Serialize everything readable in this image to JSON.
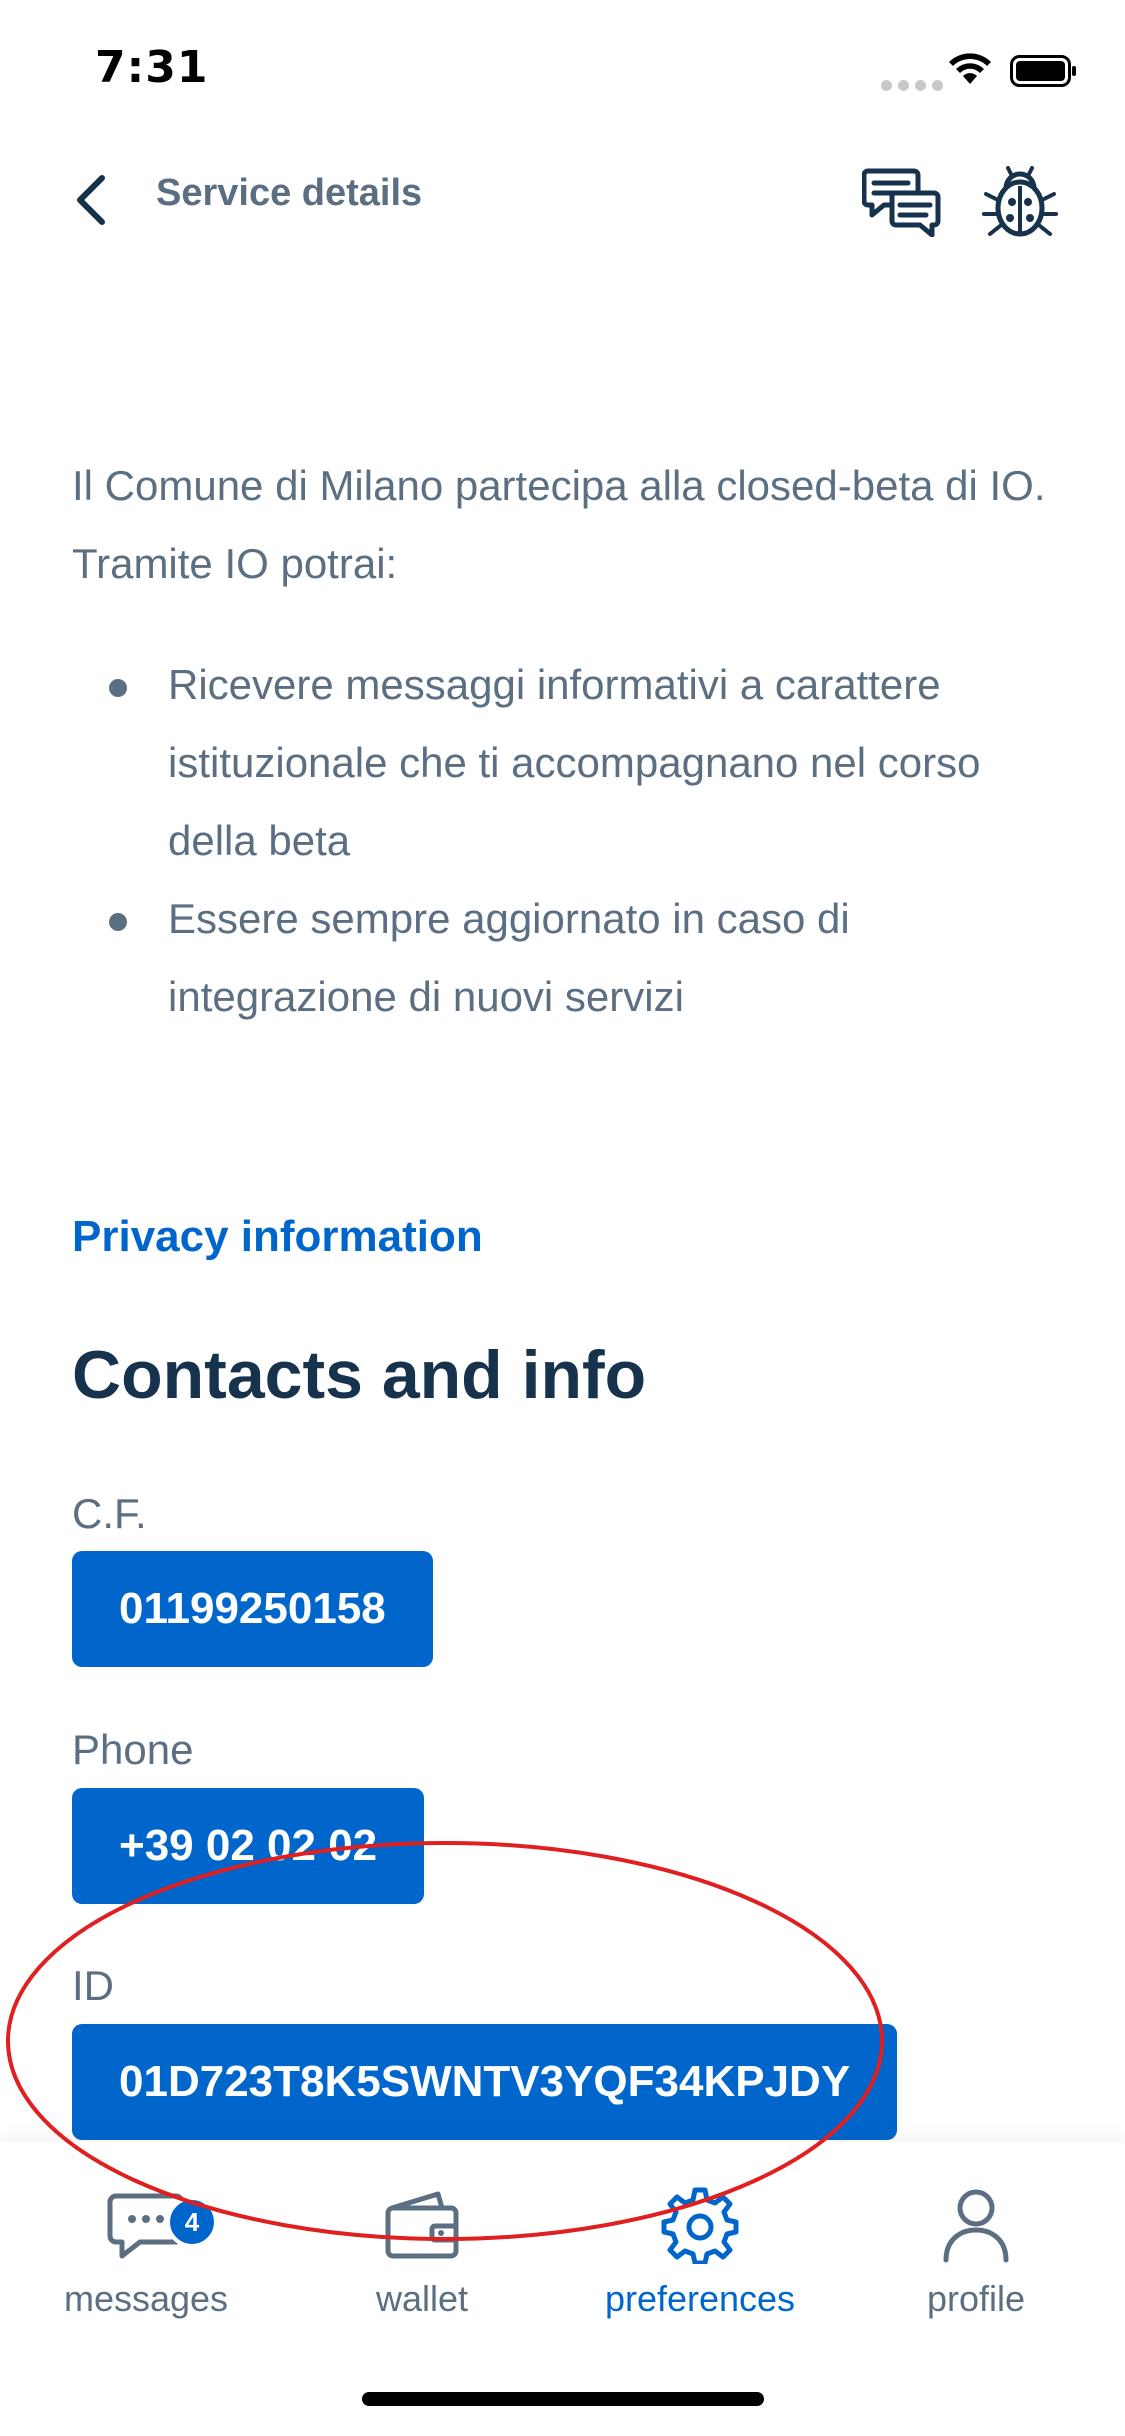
{
  "status_bar": {
    "time": "7:31"
  },
  "header": {
    "title": "Service details",
    "back_icon": "chevron-left-icon",
    "chat_icon": "chat-icon",
    "bug_icon": "bug-icon"
  },
  "description": {
    "intro": "Il Comune di Milano partecipa alla closed-beta di IO. Tramite IO potrai:",
    "bullets": [
      "Ricevere messaggi informativi a carattere istituzionale che ti accompagnano nel corso della beta",
      "Essere sempre aggiornato in caso di integrazione di nuovi servizi"
    ]
  },
  "privacy_link": "Privacy information",
  "contacts": {
    "title": "Contacts and info",
    "cf_label": "C.F.",
    "cf_value": "01199250158",
    "phone_label": "Phone",
    "phone_value": "+39 02 02 02",
    "id_label": "ID",
    "id_value": "01D723T8K5SWNTV3YQF34KPJDY"
  },
  "tabs": [
    {
      "label": "messages",
      "icon": "messages-icon",
      "badge": "4",
      "active": false
    },
    {
      "label": "wallet",
      "icon": "wallet-icon",
      "active": false
    },
    {
      "label": "preferences",
      "icon": "gear-icon",
      "active": true
    },
    {
      "label": "profile",
      "icon": "profile-icon",
      "active": false
    }
  ],
  "colors": {
    "primary": "#0066cc",
    "text": "#5c6f82",
    "heading": "#17324d",
    "annotation": "#e02020"
  }
}
